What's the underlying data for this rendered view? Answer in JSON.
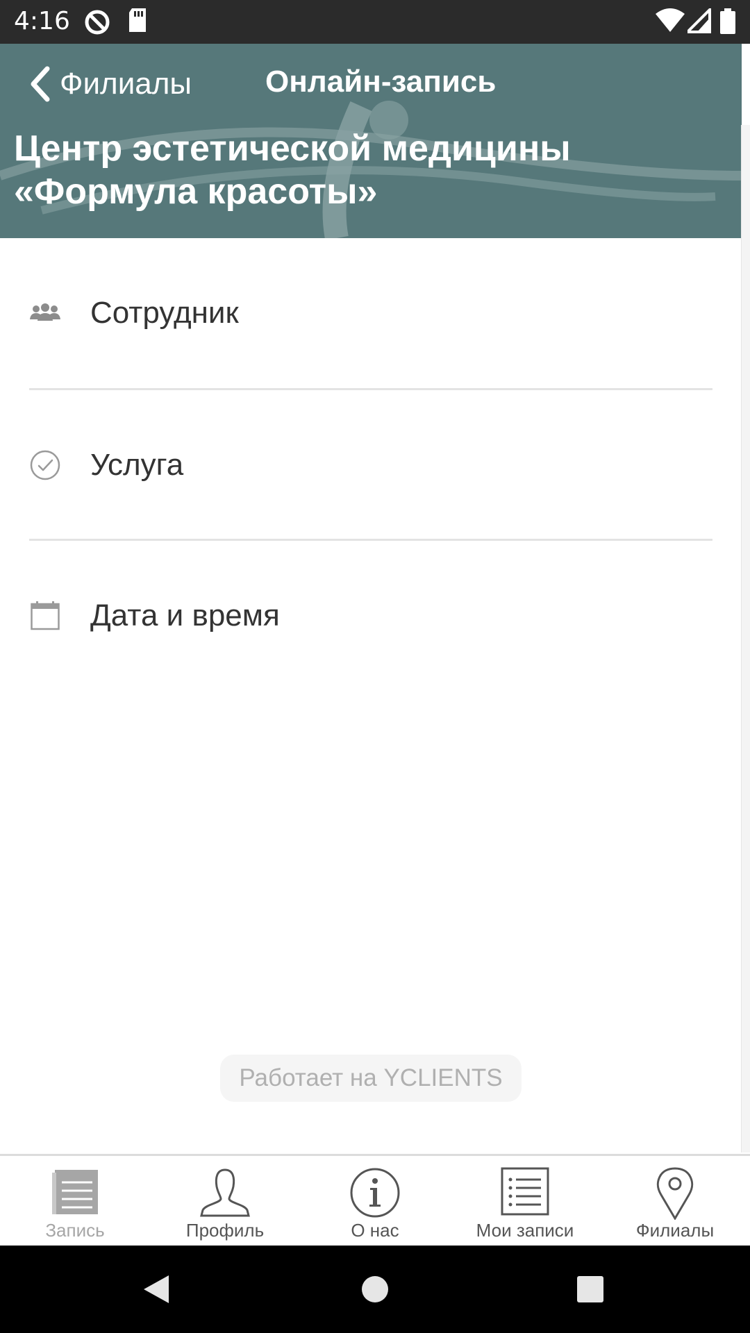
{
  "status_bar": {
    "time": "4:16"
  },
  "header": {
    "back_label": "Филиалы",
    "title": "Онлайн-запись",
    "org_name": "Центр эстетической медицины «Формула красоты»"
  },
  "rows": [
    {
      "label": "Сотрудник",
      "icon": "people-icon"
    },
    {
      "label": "Услуга",
      "icon": "check-circle-icon"
    },
    {
      "label": "Дата и время",
      "icon": "calendar-icon"
    }
  ],
  "powered_by": "Работает на YCLIENTS",
  "tabs": [
    {
      "label": "Запись",
      "icon": "booking-icon",
      "active": true
    },
    {
      "label": "Профиль",
      "icon": "profile-icon"
    },
    {
      "label": "О нас",
      "icon": "info-icon"
    },
    {
      "label": "Мои записи",
      "icon": "list-icon"
    },
    {
      "label": "Филиалы",
      "icon": "location-pin-icon"
    }
  ],
  "colors": {
    "header_bg": "#56787a",
    "statusbar_bg": "#2b2b2b",
    "navbar_bg": "#000000"
  }
}
